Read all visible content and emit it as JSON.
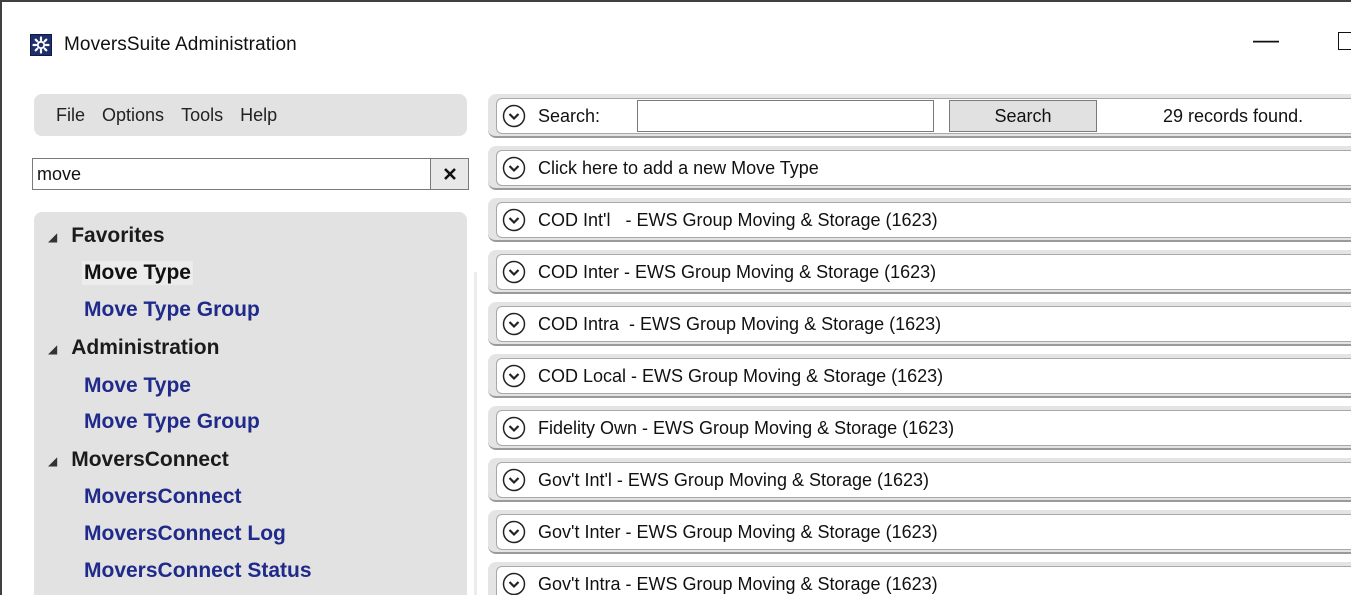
{
  "window": {
    "title": "MoversSuite Administration",
    "minimize_glyph": "—"
  },
  "menu": {
    "items": [
      "File",
      "Options",
      "Tools",
      "Help"
    ]
  },
  "filter": {
    "value": "move",
    "clear_icon": "close-icon"
  },
  "tree": {
    "groups": [
      {
        "label": "Favorites",
        "items": [
          "Move Type",
          "Move Type Group"
        ]
      },
      {
        "label": "Administration",
        "items": [
          "Move Type",
          "Move Type Group"
        ]
      },
      {
        "label": "MoversConnect",
        "items": [
          "MoversConnect",
          "MoversConnect Log",
          "MoversConnect Status"
        ]
      }
    ],
    "selected": "Favorites / Move Type"
  },
  "search": {
    "label": "Search:",
    "value": "",
    "button_label": "Search",
    "records_text": "29 records found."
  },
  "add_row": {
    "label": "Click here to add a new Move Type"
  },
  "move_types": [
    "COD Int'l   - EWS Group Moving & Storage (1623)",
    "COD Inter - EWS Group Moving & Storage (1623)",
    "COD Intra  - EWS Group Moving & Storage (1623)",
    "COD Local - EWS Group Moving & Storage (1623)",
    "Fidelity Own - EWS Group Moving & Storage (1623)",
    "Gov't Int'l - EWS Group Moving & Storage (1623)",
    "Gov't Inter - EWS Group Moving & Storage (1623)",
    "Gov't Intra - EWS Group Moving & Storage (1623)"
  ],
  "colors": {
    "link": "#1f2a8a",
    "panel": "#e2e2e2",
    "app_icon": "#1e2f6b"
  }
}
